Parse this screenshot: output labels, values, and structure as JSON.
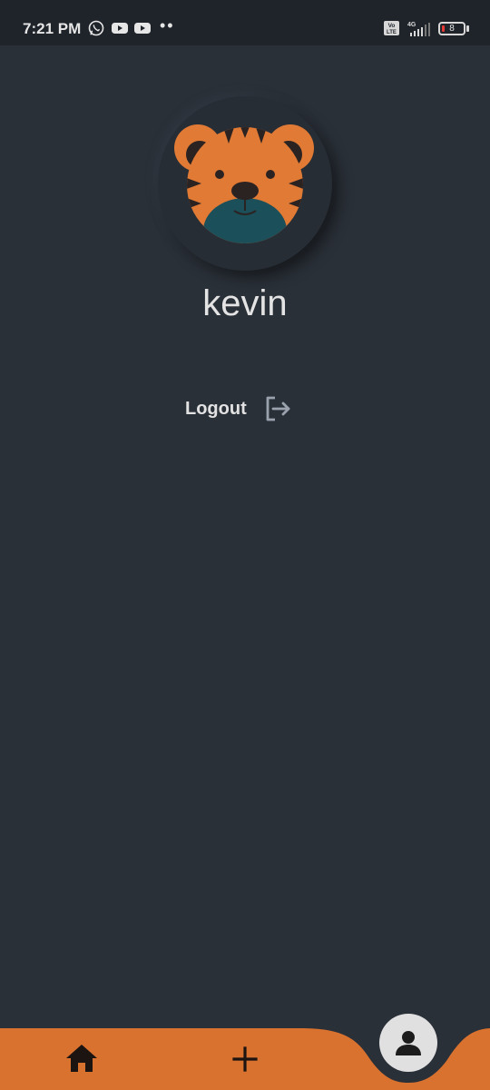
{
  "status_bar": {
    "time": "7:21 PM",
    "notification_icons": [
      "whatsapp-icon",
      "youtube-icon",
      "youtube-icon"
    ],
    "overflow_dots": "••",
    "network_label": "4G",
    "volte_label": "VoLTE",
    "battery_level": "8",
    "battery_color": "#e53935"
  },
  "profile": {
    "username": "kevin",
    "avatar_icon": "tiger-avatar-icon"
  },
  "actions": {
    "logout_label": "Logout",
    "logout_icon": "logout-icon"
  },
  "bottom_nav": {
    "items": [
      {
        "icon": "home-icon"
      },
      {
        "icon": "plus-icon"
      },
      {
        "icon": "person-icon",
        "active": true
      }
    ],
    "accent_color": "#d9712f"
  }
}
